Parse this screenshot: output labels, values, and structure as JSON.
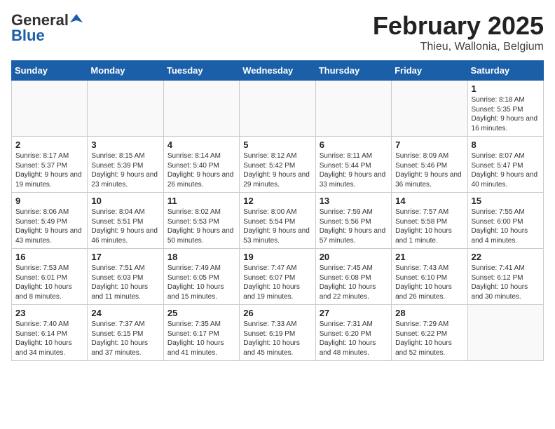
{
  "header": {
    "logo_general": "General",
    "logo_blue": "Blue",
    "title": "February 2025",
    "subtitle": "Thieu, Wallonia, Belgium"
  },
  "days_of_week": [
    "Sunday",
    "Monday",
    "Tuesday",
    "Wednesday",
    "Thursday",
    "Friday",
    "Saturday"
  ],
  "weeks": [
    [
      {
        "day": "",
        "detail": ""
      },
      {
        "day": "",
        "detail": ""
      },
      {
        "day": "",
        "detail": ""
      },
      {
        "day": "",
        "detail": ""
      },
      {
        "day": "",
        "detail": ""
      },
      {
        "day": "",
        "detail": ""
      },
      {
        "day": "1",
        "detail": "Sunrise: 8:18 AM\nSunset: 5:35 PM\nDaylight: 9 hours and 16 minutes."
      }
    ],
    [
      {
        "day": "2",
        "detail": "Sunrise: 8:17 AM\nSunset: 5:37 PM\nDaylight: 9 hours and 19 minutes."
      },
      {
        "day": "3",
        "detail": "Sunrise: 8:15 AM\nSunset: 5:39 PM\nDaylight: 9 hours and 23 minutes."
      },
      {
        "day": "4",
        "detail": "Sunrise: 8:14 AM\nSunset: 5:40 PM\nDaylight: 9 hours and 26 minutes."
      },
      {
        "day": "5",
        "detail": "Sunrise: 8:12 AM\nSunset: 5:42 PM\nDaylight: 9 hours and 29 minutes."
      },
      {
        "day": "6",
        "detail": "Sunrise: 8:11 AM\nSunset: 5:44 PM\nDaylight: 9 hours and 33 minutes."
      },
      {
        "day": "7",
        "detail": "Sunrise: 8:09 AM\nSunset: 5:46 PM\nDaylight: 9 hours and 36 minutes."
      },
      {
        "day": "8",
        "detail": "Sunrise: 8:07 AM\nSunset: 5:47 PM\nDaylight: 9 hours and 40 minutes."
      }
    ],
    [
      {
        "day": "9",
        "detail": "Sunrise: 8:06 AM\nSunset: 5:49 PM\nDaylight: 9 hours and 43 minutes."
      },
      {
        "day": "10",
        "detail": "Sunrise: 8:04 AM\nSunset: 5:51 PM\nDaylight: 9 hours and 46 minutes."
      },
      {
        "day": "11",
        "detail": "Sunrise: 8:02 AM\nSunset: 5:53 PM\nDaylight: 9 hours and 50 minutes."
      },
      {
        "day": "12",
        "detail": "Sunrise: 8:00 AM\nSunset: 5:54 PM\nDaylight: 9 hours and 53 minutes."
      },
      {
        "day": "13",
        "detail": "Sunrise: 7:59 AM\nSunset: 5:56 PM\nDaylight: 9 hours and 57 minutes."
      },
      {
        "day": "14",
        "detail": "Sunrise: 7:57 AM\nSunset: 5:58 PM\nDaylight: 10 hours and 1 minute."
      },
      {
        "day": "15",
        "detail": "Sunrise: 7:55 AM\nSunset: 6:00 PM\nDaylight: 10 hours and 4 minutes."
      }
    ],
    [
      {
        "day": "16",
        "detail": "Sunrise: 7:53 AM\nSunset: 6:01 PM\nDaylight: 10 hours and 8 minutes."
      },
      {
        "day": "17",
        "detail": "Sunrise: 7:51 AM\nSunset: 6:03 PM\nDaylight: 10 hours and 11 minutes."
      },
      {
        "day": "18",
        "detail": "Sunrise: 7:49 AM\nSunset: 6:05 PM\nDaylight: 10 hours and 15 minutes."
      },
      {
        "day": "19",
        "detail": "Sunrise: 7:47 AM\nSunset: 6:07 PM\nDaylight: 10 hours and 19 minutes."
      },
      {
        "day": "20",
        "detail": "Sunrise: 7:45 AM\nSunset: 6:08 PM\nDaylight: 10 hours and 22 minutes."
      },
      {
        "day": "21",
        "detail": "Sunrise: 7:43 AM\nSunset: 6:10 PM\nDaylight: 10 hours and 26 minutes."
      },
      {
        "day": "22",
        "detail": "Sunrise: 7:41 AM\nSunset: 6:12 PM\nDaylight: 10 hours and 30 minutes."
      }
    ],
    [
      {
        "day": "23",
        "detail": "Sunrise: 7:40 AM\nSunset: 6:14 PM\nDaylight: 10 hours and 34 minutes."
      },
      {
        "day": "24",
        "detail": "Sunrise: 7:37 AM\nSunset: 6:15 PM\nDaylight: 10 hours and 37 minutes."
      },
      {
        "day": "25",
        "detail": "Sunrise: 7:35 AM\nSunset: 6:17 PM\nDaylight: 10 hours and 41 minutes."
      },
      {
        "day": "26",
        "detail": "Sunrise: 7:33 AM\nSunset: 6:19 PM\nDaylight: 10 hours and 45 minutes."
      },
      {
        "day": "27",
        "detail": "Sunrise: 7:31 AM\nSunset: 6:20 PM\nDaylight: 10 hours and 48 minutes."
      },
      {
        "day": "28",
        "detail": "Sunrise: 7:29 AM\nSunset: 6:22 PM\nDaylight: 10 hours and 52 minutes."
      },
      {
        "day": "",
        "detail": ""
      }
    ]
  ]
}
